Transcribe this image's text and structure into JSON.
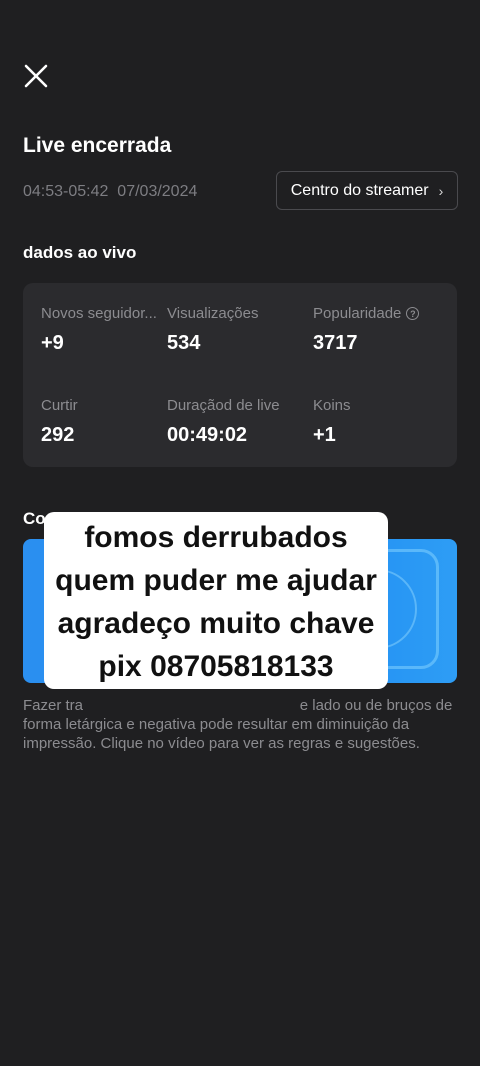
{
  "header": {
    "close_icon": "close-icon",
    "title": "Live encerrada",
    "time_range": "04:53-05:42  07/03/2024",
    "streamer_button": "Centro do streamer",
    "streamer_chevron_icon": "chevron-right-icon"
  },
  "live_data": {
    "section_title": "dados ao vivo",
    "stats": [
      {
        "label": "Novos seguidor...",
        "value": "+9"
      },
      {
        "label": "Visualizações",
        "value": "534"
      },
      {
        "label": "Popularidade",
        "value": "3717",
        "icon": "help-icon"
      },
      {
        "label": "Curtir",
        "value": "292"
      },
      {
        "label": "Duraçãod de live",
        "value": "00:49:02"
      },
      {
        "label": "Koins",
        "value": "+1"
      }
    ]
  },
  "tips": {
    "section_title": "Como",
    "banner_color": "#1d8bf1",
    "description": "Fazer tra                                                    e lado ou de bruços de forma letárgica e negativa pode resultar em diminuição da impressão. Clique no vídeo para ver as regras e sugestões."
  },
  "overlay_caption": {
    "lines": [
      "fomos derrubados",
      "quem puder me ajudar",
      "agradeço muito chave",
      "pix 08705818133"
    ]
  }
}
